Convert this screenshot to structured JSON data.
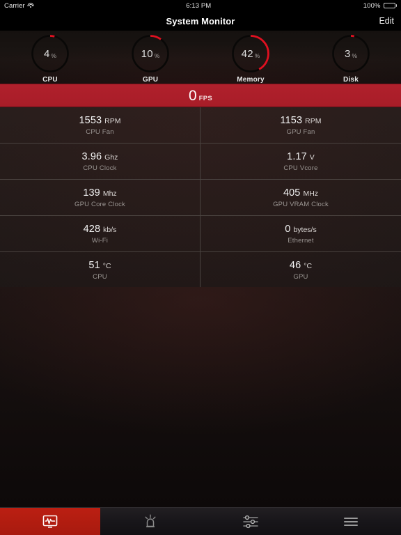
{
  "statusbar": {
    "carrier": "Carrier",
    "wifi_icon": "wifi-icon",
    "time": "6:13 PM",
    "battery_percent": "100%",
    "battery_icon": "battery-full-icon"
  },
  "navbar": {
    "title": "System Monitor",
    "edit_label": "Edit"
  },
  "gauges": [
    {
      "value": "4",
      "unit": "%",
      "label": "CPU",
      "percent": 4,
      "arc_color": "#e01020"
    },
    {
      "value": "10",
      "unit": "%",
      "label": "GPU",
      "percent": 10,
      "arc_color": "#e01020"
    },
    {
      "value": "42",
      "unit": "%",
      "label": "Memory",
      "percent": 42,
      "arc_color": "#e01020"
    },
    {
      "value": "3",
      "unit": "%",
      "label": "Disk",
      "percent": 3,
      "arc_color": "#e01020"
    }
  ],
  "fps": {
    "value": "0",
    "unit": "FPS",
    "background_color": "#b0202c"
  },
  "stats": [
    [
      {
        "value": "1553",
        "unit": "RPM",
        "label": "CPU Fan"
      },
      {
        "value": "1153",
        "unit": "RPM",
        "label": "GPU Fan"
      }
    ],
    [
      {
        "value": "3.96",
        "unit": "Ghz",
        "label": "CPU Clock"
      },
      {
        "value": "1.17",
        "unit": "V",
        "label": "CPU Vcore"
      }
    ],
    [
      {
        "value": "139",
        "unit": "Mhz",
        "label": "GPU Core Clock"
      },
      {
        "value": "405",
        "unit": "MHz",
        "label": "GPU VRAM Clock"
      }
    ],
    [
      {
        "value": "428",
        "unit": "kb/s",
        "label": "Wi-Fi"
      },
      {
        "value": "0",
        "unit": "bytes/s",
        "label": "Ethernet"
      }
    ],
    [
      {
        "value": "51",
        "unit": "°C",
        "label": "CPU"
      },
      {
        "value": "46",
        "unit": "°C",
        "label": "GPU"
      }
    ]
  ],
  "tabbar": {
    "active_color": "#bb1f12",
    "items": [
      {
        "icon": "monitor-waveform-icon",
        "active": true
      },
      {
        "icon": "alarm-light-icon",
        "active": false
      },
      {
        "icon": "sliders-icon",
        "active": false
      },
      {
        "icon": "hamburger-menu-icon",
        "active": false
      }
    ]
  }
}
